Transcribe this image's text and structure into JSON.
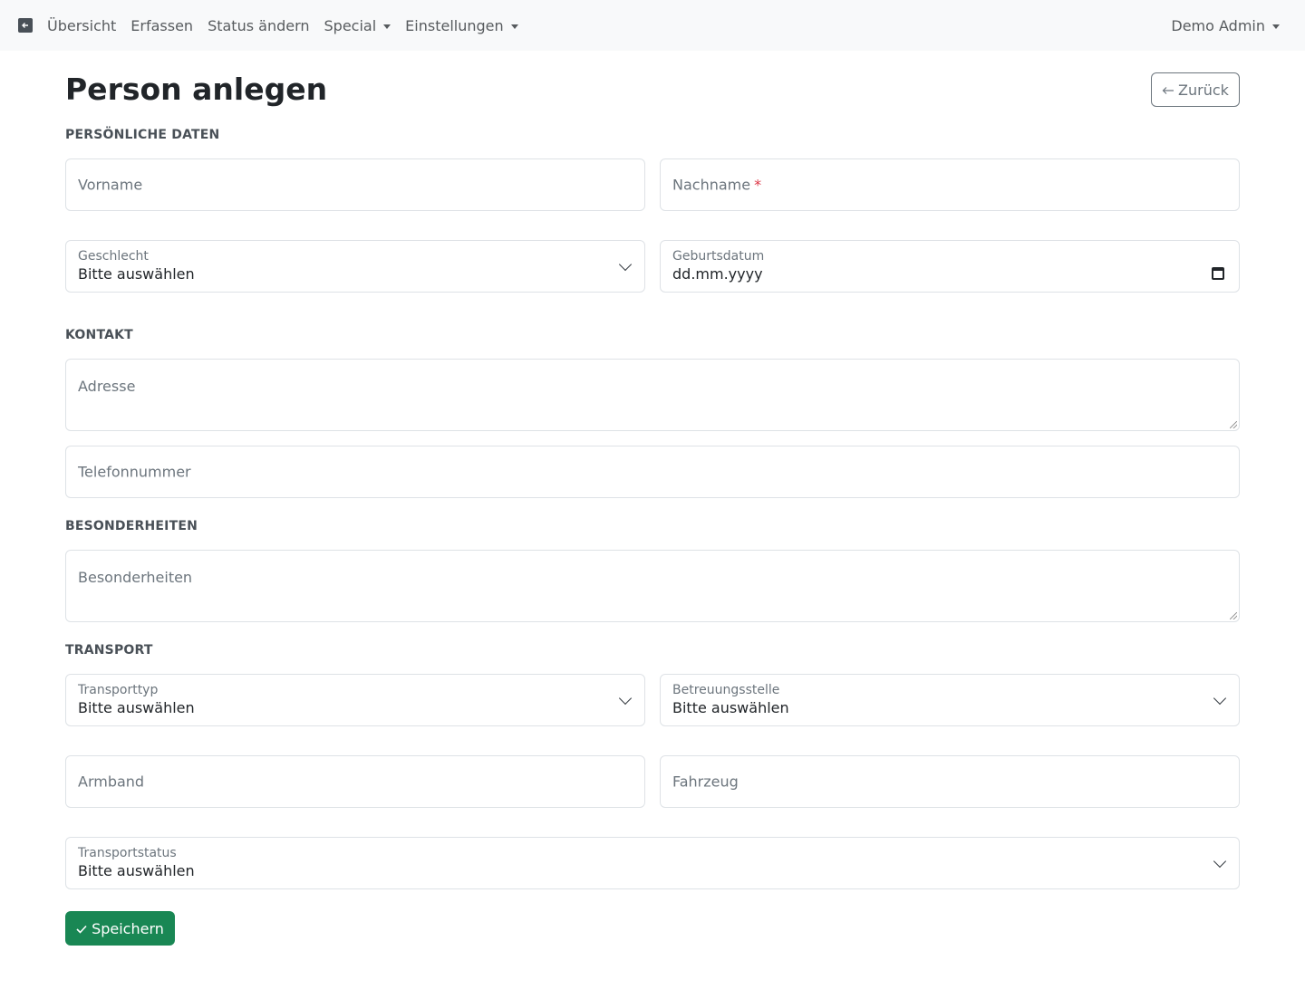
{
  "nav": {
    "items": [
      {
        "label": "Übersicht",
        "dropdown": false
      },
      {
        "label": "Erfassen",
        "dropdown": false
      },
      {
        "label": "Status ändern",
        "dropdown": false
      },
      {
        "label": "Special",
        "dropdown": true
      },
      {
        "label": "Einstellungen",
        "dropdown": true
      }
    ],
    "user": "Demo Admin"
  },
  "page": {
    "title": "Person anlegen",
    "back_label": "Zurück",
    "save_label": "Speichern"
  },
  "sections": {
    "personal": "PERSÖNLICHE DATEN",
    "contact": "KONTAKT",
    "special": "BESONDERHEITEN",
    "transport": "TRANSPORT"
  },
  "fields": {
    "vorname": {
      "placeholder": "Vorname",
      "value": ""
    },
    "nachname": {
      "placeholder": "Nachname",
      "required_mark": "*",
      "value": ""
    },
    "geschlecht": {
      "label": "Geschlecht",
      "value": "Bitte auswählen"
    },
    "geburtsdatum": {
      "label": "Geburtsdatum",
      "value": "dd.mm.yyyy"
    },
    "adresse": {
      "placeholder": "Adresse",
      "value": ""
    },
    "telefon": {
      "placeholder": "Telefonnummer",
      "value": ""
    },
    "besonderheiten": {
      "placeholder": "Besonderheiten",
      "value": ""
    },
    "transporttyp": {
      "label": "Transporttyp",
      "value": "Bitte auswählen"
    },
    "betreuungsstelle": {
      "label": "Betreuungsstelle",
      "value": "Bitte auswählen"
    },
    "armband": {
      "placeholder": "Armband",
      "value": ""
    },
    "fahrzeug": {
      "placeholder": "Fahrzeug",
      "value": ""
    },
    "transportstatus": {
      "label": "Transportstatus",
      "value": "Bitte auswählen"
    }
  },
  "colors": {
    "primary_success": "#198754",
    "navbar_bg": "#f8f9fa",
    "required": "#dc3545"
  }
}
